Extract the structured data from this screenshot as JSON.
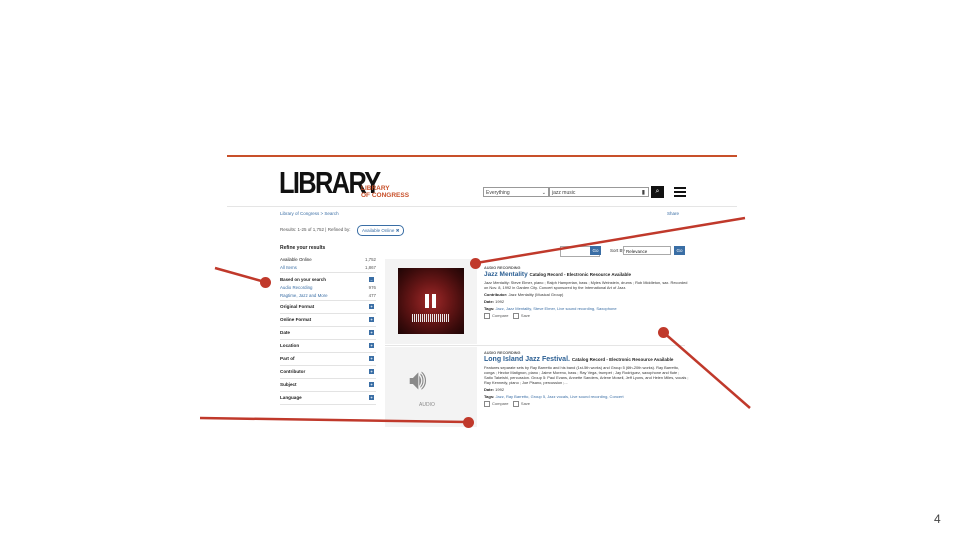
{
  "header": {
    "logo_word": "LIBRARY",
    "logo_sub_line1": "LIBRARY",
    "logo_sub_line2": "OF CONGRESS",
    "scope_value": "Everything",
    "search_value": "jazz music"
  },
  "breadcrumb": "Library of Congress > Search",
  "share_label": "Share",
  "results_info": "Results: 1-25 of 1,752  |  Refined by:",
  "refine_pill": "Available Online ✖",
  "sidebar": {
    "title": "Refine your results",
    "availability": [
      {
        "label": "Available Online",
        "count": "1,752"
      },
      {
        "label": "All Items",
        "count": "1,867"
      }
    ],
    "based_title": "Based on your search",
    "based": [
      {
        "label": "Audio Recording",
        "count": "976"
      },
      {
        "label": "Ragtime, Jazz and More",
        "count": "477"
      }
    ],
    "facets": [
      "Original Format",
      "Online Format",
      "Date",
      "Location",
      "Part of",
      "Contributor",
      "Subject",
      "Language"
    ]
  },
  "controls": {
    "go": "Go",
    "sort_label": "Sort By",
    "sort_value": "Relevance"
  },
  "results": [
    {
      "type": "AUDIO RECORDING",
      "title": "Jazz Mentality",
      "record": "Catalog Record - Electronic Resource Available",
      "desc": "Jazz Mentality: Steve Elmer, piano ; Ralph Hamperian, bass ; Myles Weinstein, drums ; Rob Middleton, sax. Recorded on Nov. 8, 1992 in Garden City. Concert sponsored by the International Art of Jazz.",
      "contributor_label": "Contributor:",
      "contributor": "Jazz Mentality (Musical Group)",
      "date_label": "Date:",
      "date": "1992",
      "tags_label": "Tags:",
      "tags": "Jazz, Jazz Mentality, Steve Elmer, Live sound recording, Saxophone",
      "compare": "Compare",
      "save": "Save"
    },
    {
      "type": "AUDIO RECORDING",
      "title": "Long Island Jazz Festival.",
      "record": "Catalog Record - Electronic Resource Available",
      "desc": "Features separate sets by Ray Barretto and his band (1st-5th works) and Group 5 (6th-20th works). Ray Barretto, conga ; Hector Matignon, piano ; Jaime Moreno, bass ; Ray Vega, trumpet ; Jay Rodriguez, saxophone and flute ; Satio Takeishi, percussion. Group 5: Paul Evans, Annette Sanders, Arlene Mosell, Jeff Lyons, and Helen Miles, vocals ; Ray Kennedy, piano ; Joe Pisano, percussion ;...",
      "date_label": "Date:",
      "date": "1992",
      "tags_label": "Tags:",
      "tags": "Jazz, Ray Barretto, Group 5, Jazz vocals, Live sound recording, Concert",
      "compare": "Compare",
      "save": "Save",
      "audio_label": "AUDIO"
    }
  ],
  "page_number": "4"
}
